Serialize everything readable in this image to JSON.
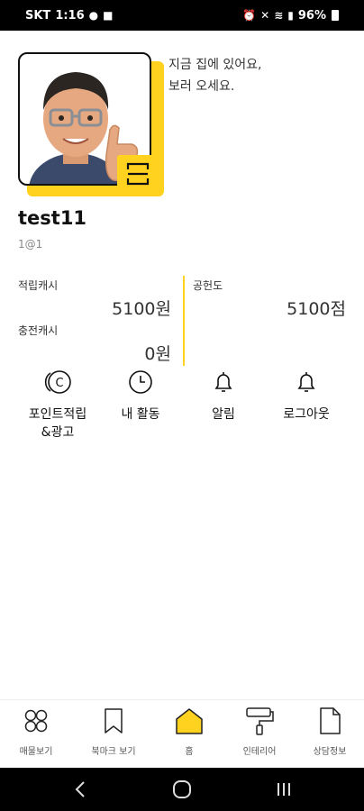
{
  "status_bar": {
    "carrier": "SKT",
    "time": "1:16",
    "battery": "96%"
  },
  "profile": {
    "status_message": "지금 집에 있어요,\n 보러 오세요.",
    "username": "test11",
    "user_id": "1@1"
  },
  "stats": {
    "earned_cash_label": "적립캐시",
    "earned_cash_value": "5100원",
    "charged_cash_label": "충전캐시",
    "charged_cash_value": "0원",
    "contribution_label": "공헌도",
    "contribution_value": "5100점"
  },
  "actions": [
    {
      "label": "포인트적립\n&광고",
      "icon": "coin-icon"
    },
    {
      "label": "내 활동",
      "icon": "clock-icon"
    },
    {
      "label": "알림",
      "icon": "bell-icon"
    },
    {
      "label": "로그아웃",
      "icon": "bell-icon"
    }
  ],
  "bottom_nav": [
    {
      "label": "매물보기",
      "icon": "grid-icon"
    },
    {
      "label": "북마크 보기",
      "icon": "bookmark-icon"
    },
    {
      "label": "홈",
      "icon": "home-icon"
    },
    {
      "label": "인테리어",
      "icon": "paint-roller-icon"
    },
    {
      "label": "상담정보",
      "icon": "document-icon"
    }
  ],
  "colors": {
    "accent": "#ffd21f",
    "text": "#111111"
  }
}
